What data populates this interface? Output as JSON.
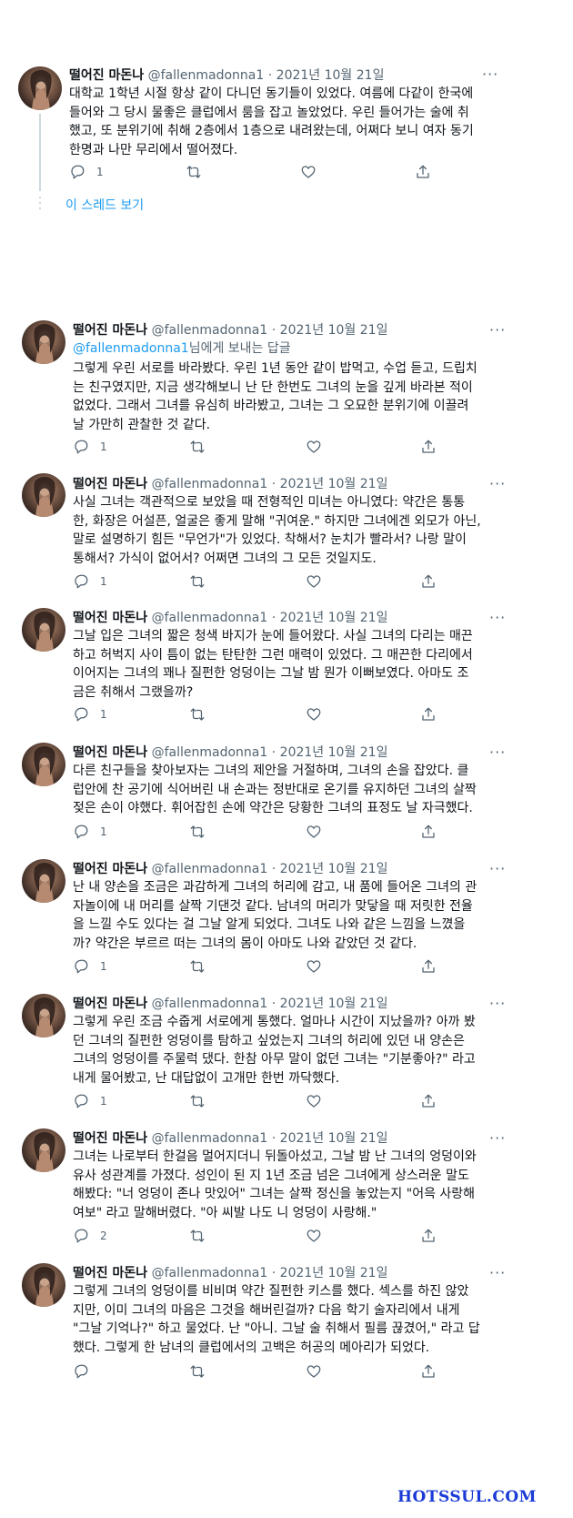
{
  "author": {
    "name": "떨어진 마돈나",
    "handle": "@fallenmadonna1",
    "date": "2021년 10월 21일",
    "avatar_icon": "avatar-painting"
  },
  "show_thread": "이 스레드 보기",
  "reply_to_prefix": "@fallenmadonna1",
  "reply_to_suffix": "님에게 보내는 답글",
  "more_icon": "···",
  "tweets": [
    {
      "lines": [
        "대학교 1학년 시절 항상 같이 다니던 동기들이 있었다. 여름에 다같이 한국에",
        "들어와 그 당시 물좋은 클럽에서 룸을 잡고 놀았었다.  우린 들어가는 술에 취",
        "했고, 또 분위기에 취해 2층에서 1층으로 내려왔는데, 어쩌다 보니 여자 동기",
        "한명과 나만 무리에서 떨어졌다."
      ],
      "replies": "1"
    },
    {
      "lines": [
        "그렇게 우린 서로를 바라봤다.  우린 1년 동안 같이 밥먹고, 수업 듣고, 드립치",
        "는 친구였지만, 지금 생각해보니 난 단 한번도 그녀의 눈을 깊게 바라본 적이",
        "없었다.  그래서 그녀를 유심히 바라봤고, 그녀는 그 오묘한 분위기에 이끌려",
        "날 가만히 관찰한 것 같다."
      ],
      "replies": "1"
    },
    {
      "lines": [
        "사실 그녀는 객관적으로 보았을 때 전형적인 미녀는 아니였다: 약간은 통통",
        "한, 화장은 어설픈, 얼굴은 좋게 말해 \"귀여운.\" 하지만 그녀에겐 외모가 아닌,",
        "말로 설명하기 힘든 \"무언가\"가 있었다. 착해서? 눈치가 빨라서? 나랑 말이",
        "통해서? 가식이 없어서? 어쩌면 그녀의 그 모든 것일지도."
      ],
      "replies": "1"
    },
    {
      "lines": [
        "그날 입은 그녀의 짧은 청색 바지가 눈에 들어왔다. 사실 그녀의 다리는 매끈",
        "하고 허벅지 사이 틈이 없는 탄탄한 그런 매력이 있었다.  그 매끈한 다리에서",
        "이어지는 그녀의 꽤나 질펀한 엉덩이는 그날 밤 뭔가 이뻐보였다. 아마도 조",
        "금은 취해서 그랬을까?"
      ],
      "replies": "1"
    },
    {
      "lines": [
        "다른 친구들을 찾아보자는 그녀의 제안을 거절하며, 그녀의 손을 잡았다.  클",
        "럽안에 찬 공기에 식어버린 내 손과는 정반대로 온기를 유지하던 그녀의 살짝",
        "젖은 손이 야했다. 휘어잡힌 손에 약간은 당황한 그녀의 표정도 날 자극했다."
      ],
      "replies": "1"
    },
    {
      "lines": [
        "난 내 양손을 조금은 과감하게 그녀의 허리에 감고, 내 품에 들어온 그녀의 관",
        "자놀이에 내 머리를 살짝 기댄것 같다. 남녀의 머리가 맞닿을 때 저릿한 전율",
        "을 느낄 수도 있다는 걸 그날 알게 되었다.  그녀도 나와 같은 느낌을 느꼈을",
        "까? 약간은 부르르 떠는 그녀의 몸이 아마도 나와 같았던 것 같다."
      ],
      "replies": "1"
    },
    {
      "lines": [
        "그렇게 우린 조금 수줍게 서로에게 통했다. 얼마나 시간이 지났을까? 아까 봤",
        "던 그녀의 질펀한 엉덩이를 탐하고 싶었는지 그녀의 허리에 있던 내 양손은",
        "그녀의 엉덩이를 주물럭 댔다.  한참 아무 말이 없던 그녀는 \"기분좋아?\" 라고",
        "내게 물어봤고, 난 대답없이 고개만 한번 까닥했다."
      ],
      "replies": "1"
    },
    {
      "lines": [
        "그녀는 나로부터 한걸음 멀어지더니 뒤돌아섰고, 그날 밤 난 그녀의 엉덩이와",
        "유사 성관계를 가졌다. 성인이 된 지 1년 조금 넘은 그녀에게 상스러운 말도",
        "해봤다: \"너 엉덩이 존나 맛있어\" 그녀는 살짝 정신을 놓았는지 \"어윽 사랑해",
        "여보\" 라고 말해버렸다. \"아 씨발 나도 니 엉덩이 사랑해.\""
      ],
      "replies": "2"
    },
    {
      "lines": [
        "그렇게 그녀의 엉덩이를 비비며 약간 질펀한 키스를 했다. 섹스를 하진 않았",
        "지만, 이미 그녀의 마음은 그것을 해버린걸까? 다음 학기 술자리에서 내게",
        "\"그날 기억나?\" 하고 물었다. 난 \"아니. 그날 술 취해서 필름 끊겼어,\" 라고 답",
        "했다.  그렇게 한 남녀의 클럽에서의 고백은 허공의 메아리가 되었다."
      ],
      "replies": ""
    }
  ],
  "watermark": "HOTSSUL.COM"
}
